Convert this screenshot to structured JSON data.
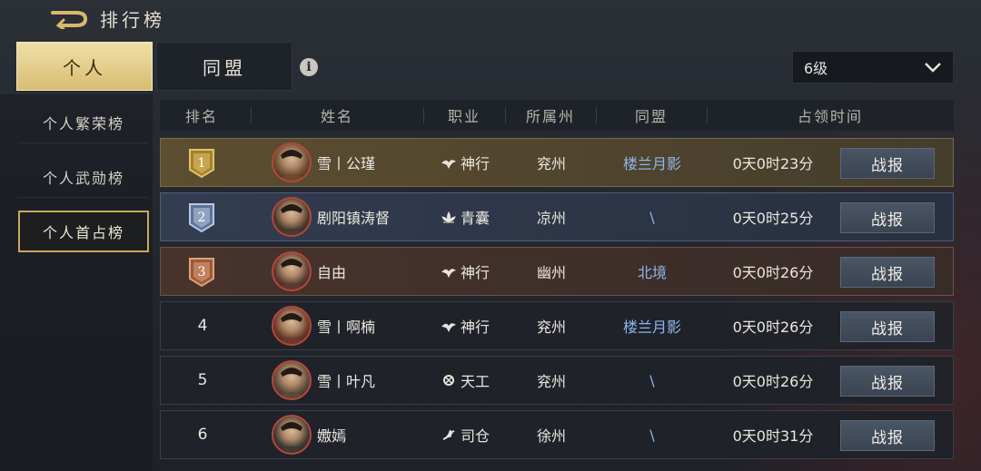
{
  "header": {
    "title": "排行榜",
    "back_icon": "back-arrow-icon"
  },
  "tabs": [
    {
      "label": "个人",
      "active": true
    },
    {
      "label": "同盟",
      "active": false
    }
  ],
  "info_icon": {
    "glyph": "i",
    "name": "info-icon"
  },
  "level_select": {
    "value": "6级",
    "icon": "chevron-down-icon"
  },
  "sidebar": {
    "items": [
      {
        "label": "个人繁荣榜",
        "active": false
      },
      {
        "label": "个人武勋榜",
        "active": false
      },
      {
        "label": "个人首占榜",
        "active": true
      }
    ]
  },
  "table": {
    "headers": [
      "排名",
      "姓名",
      "职业",
      "所属州",
      "同盟",
      "占领时间"
    ],
    "rows": [
      {
        "rank": "1",
        "name": "雪丨公瑾",
        "job": "神行",
        "job_icon": "bird-icon",
        "state": "兖州",
        "alliance": "楼兰月影",
        "time": "0天0时23分",
        "button": "战报",
        "style": "gold"
      },
      {
        "rank": "2",
        "name": "剧阳镇涛督",
        "job": "青囊",
        "job_icon": "lotus-icon",
        "state": "凉州",
        "alliance": "\\",
        "time": "0天0时25分",
        "button": "战报",
        "style": "silver"
      },
      {
        "rank": "3",
        "name": "自由",
        "job": "神行",
        "job_icon": "bird-icon",
        "state": "幽州",
        "alliance": "北境",
        "time": "0天0时26分",
        "button": "战报",
        "style": "bronze"
      },
      {
        "rank": "4",
        "name": "雪丨啊楠",
        "job": "神行",
        "job_icon": "bird-icon",
        "state": "兖州",
        "alliance": "楼兰月影",
        "time": "0天0时26分",
        "button": "战报",
        "style": "normal"
      },
      {
        "rank": "5",
        "name": "雪丨叶凡",
        "job": "天工",
        "job_icon": "gear-icon",
        "state": "兖州",
        "alliance": "\\",
        "time": "0天0时26分",
        "button": "战报",
        "style": "normal"
      },
      {
        "rank": "6",
        "name": "嫐嫣",
        "job": "司仓",
        "job_icon": "grain-icon",
        "state": "徐州",
        "alliance": "\\",
        "time": "0天0时31分",
        "button": "战报",
        "style": "normal"
      }
    ]
  },
  "colors": {
    "accent_gold": "#d8bd73",
    "alliance_link": "#8fb6ec",
    "button_bg": "#3a4452"
  }
}
